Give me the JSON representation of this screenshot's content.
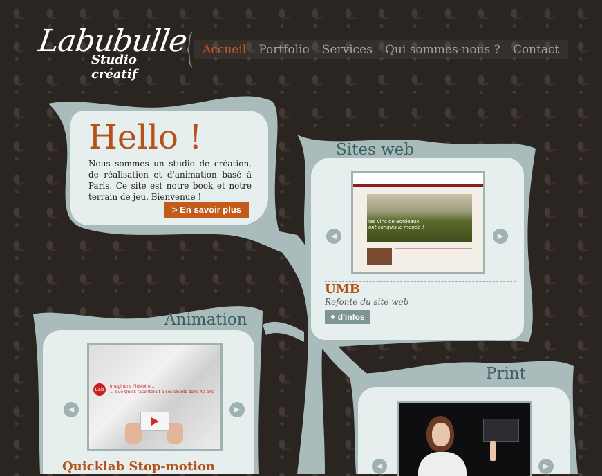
{
  "logo": {
    "line1": "Labubulle",
    "line2": "Studio créatif"
  },
  "nav": {
    "items": [
      {
        "label": "Accueil",
        "active": true
      },
      {
        "label": "Portfolio"
      },
      {
        "label": "Services"
      },
      {
        "label": "Qui sommes-nous ?"
      },
      {
        "label": "Contact"
      }
    ]
  },
  "hello": {
    "title": "Hello !",
    "text": "Nous sommes un studio de création, de réalisation et d'animation basé à Paris. Ce site est notre book et notre terrain de jeu. Bienvenue !",
    "button": "> En savoir plus"
  },
  "web": {
    "title": "Sites web",
    "project_title": "UMB",
    "project_sub": "Refonte du site web",
    "button": "+ d'infos",
    "shot_headline": "les Vins de Bordeaux",
    "shot_tagline": "ont conquis le monde !"
  },
  "animation": {
    "title": "Animation",
    "project_title": "Quicklab Stop-motion",
    "shot_line1": "Imaginons l'histoire...",
    "shot_line2": "... que Quick raconterait à ses clients dans 40 ans",
    "badge": "Lab"
  },
  "print": {
    "title": "Print"
  },
  "colors": {
    "accent": "#c35b1d",
    "panel": "#e7eeee",
    "frame": "#9fb1b1",
    "background": "#2b2522"
  }
}
